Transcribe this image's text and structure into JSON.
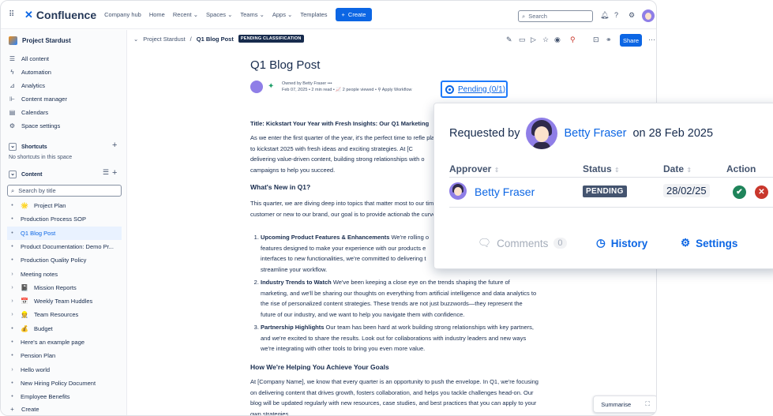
{
  "topnav": {
    "product": "Confluence",
    "items": [
      "Company hub",
      "Home",
      "Recent ⌄",
      "Spaces ⌄",
      "Teams ⌄",
      "Apps ⌄",
      "Templates"
    ],
    "create_label": "Create",
    "search_placeholder": "Search"
  },
  "sidebar": {
    "space_name": "Project Stardust",
    "nav": [
      "All content",
      "Automation",
      "Analytics",
      "Content manager",
      "Calendars",
      "Space settings"
    ],
    "shortcuts_label": "Shortcuts",
    "shortcuts_empty": "No shortcuts in this space",
    "content_label": "Content",
    "search_placeholder": "Search by title",
    "tree": [
      {
        "label": "Project Plan",
        "emoji": "🌟",
        "arrow": "•"
      },
      {
        "label": "Production Process SOP",
        "emoji": "",
        "arrow": "•"
      },
      {
        "label": "Q1 Blog Post",
        "emoji": "",
        "arrow": "•",
        "selected": true
      },
      {
        "label": "Product Documentation: Demo Pr...",
        "emoji": "",
        "arrow": "•"
      },
      {
        "label": "Production Quality Policy",
        "emoji": "",
        "arrow": "•"
      },
      {
        "label": "Meeting notes",
        "emoji": "",
        "arrow": "›"
      },
      {
        "label": "Mission Reports",
        "emoji": "📓",
        "arrow": "›"
      },
      {
        "label": "Weekly Team Huddles",
        "emoji": "📅",
        "arrow": "›"
      },
      {
        "label": "Team Resources",
        "emoji": "👷",
        "arrow": "›"
      },
      {
        "label": "Budget",
        "emoji": "💰",
        "arrow": "•"
      },
      {
        "label": "Here's an example page",
        "emoji": "",
        "arrow": "•"
      },
      {
        "label": "Pension Plan",
        "emoji": "",
        "arrow": "•"
      },
      {
        "label": "Hello world",
        "emoji": "",
        "arrow": "›"
      },
      {
        "label": "New Hiring Policy Document",
        "emoji": "",
        "arrow": "•"
      },
      {
        "label": "Employee Benefits",
        "emoji": "",
        "arrow": "•"
      }
    ],
    "create_label": "Create"
  },
  "breadcrumb": {
    "space": "Project Stardust",
    "current": "Q1 Blog Post",
    "badge": "PENDING CLASSIFICATION"
  },
  "toolbar": {
    "share_label": "Share"
  },
  "page": {
    "title": "Q1 Blog Post",
    "owner_line": "Owned by Betty Fraser  •••",
    "meta_line": "Feb 07, 2025  •  2 min read  •  📈 2 people viewed  •  ⚲ Apply Workflow",
    "pending_label": "Pending (0/1)",
    "post_title": "Title: Kickstart Your Year with Fresh Insights: Our Q1 Marketing",
    "intro": "As we enter the first quarter of the year, it's the perfect time to refle plan to kickstart 2025 with fresh ideas and exciting strategies. At [C delivering value-driven content, building strong relationships with o campaigns to help you succeed.",
    "h_new": "What's New in Q1?",
    "new_p": "This quarter, we are diving deep into topics that matter most to our time customer or new to our brand, our goal is to provide actionab the curve.",
    "points": [
      {
        "bold": "Upcoming Product Features & Enhancements",
        "text": " We're rolling o features designed to make your experience with our products e interfaces to new functionalities, we're committed to delivering t streamline your workflow."
      },
      {
        "bold": "Industry Trends to Watch",
        "text": " We've been keeping a close eye on the trends shaping the future of marketing, and we'll be sharing our thoughts on everything from artificial intelligence and data analytics to the rise of personalized content strategies. These trends are not just buzzwords—they represent the future of our industry, and we want to help you navigate them with confidence."
      },
      {
        "bold": "Partnership Highlights",
        "text": " Our team has been hard at work building strong relationships with key partners, and we're excited to share the results. Look out for collaborations with industry leaders and new ways we're integrating with other tools to bring you even more value."
      }
    ],
    "h_help": "How We're Helping You Achieve Your Goals",
    "help_p": "At [Company Name], we know that every quarter is an opportunity to push the envelope. In Q1, we're focusing on delivering content that drives growth, fosters collaboration, and helps you tackle challenges head-on. Our blog will be updated regularly with new resources, case studies, and best practices that you can apply to your own strategies."
  },
  "summarise_label": "Summarise",
  "approval_popup": {
    "requested_by_prefix": "Requested by",
    "requester": "Betty Fraser",
    "requested_on": "on 28 Feb 2025",
    "columns": [
      "Approver",
      "Status",
      "Date",
      "Action"
    ],
    "approver": "Betty Fraser",
    "status": "PENDING",
    "date": "28/02/25",
    "comments_label": "Comments",
    "comments_count": "0",
    "history_label": "History",
    "settings_label": "Settings",
    "approve_color": "#1f845a",
    "reject_color": "#c9372c"
  },
  "colors": {
    "brand": "#0c66e4"
  }
}
